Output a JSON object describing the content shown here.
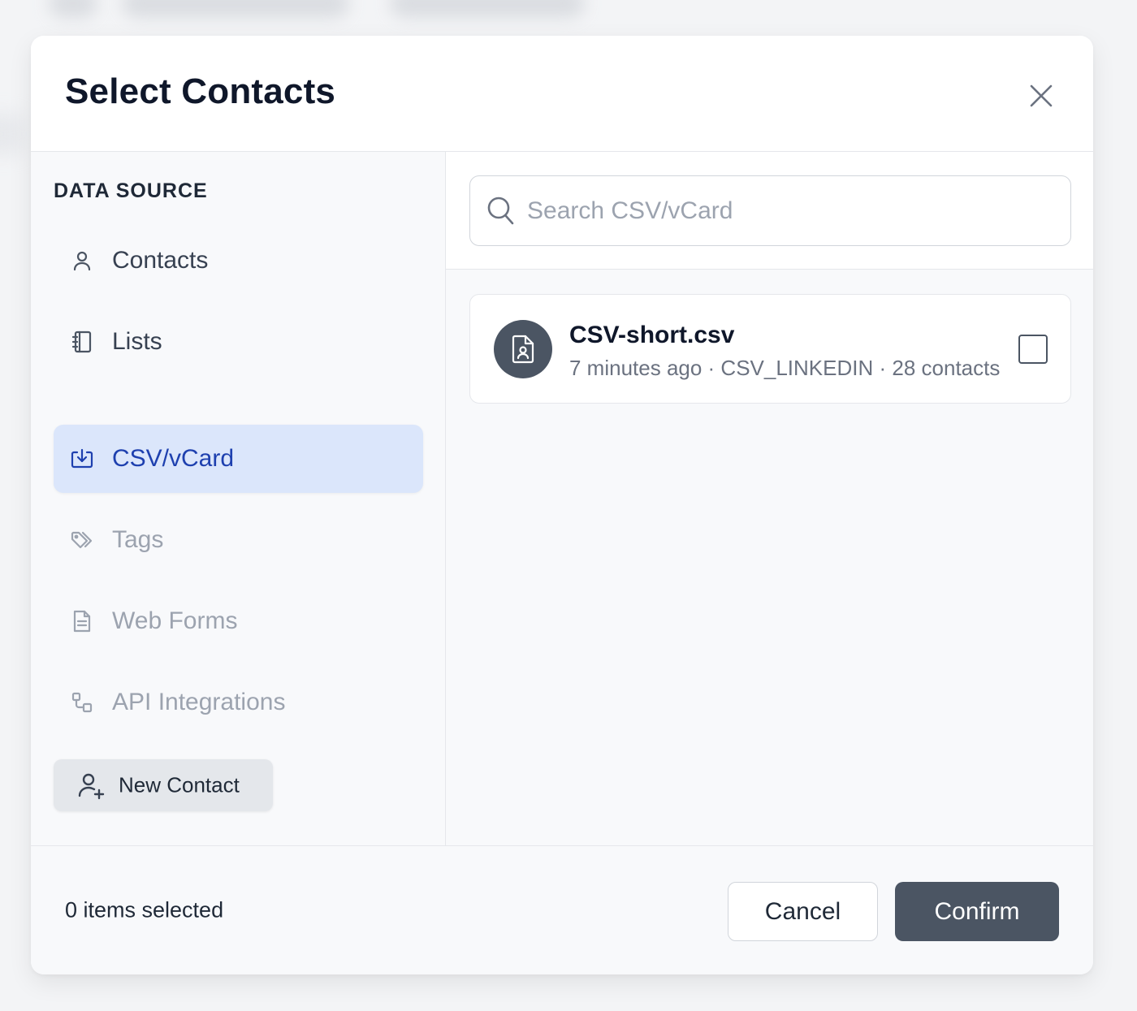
{
  "modal": {
    "title": "Select Contacts"
  },
  "sidebar": {
    "heading": "DATA SOURCE",
    "items": [
      {
        "label": "Contacts",
        "icon": "user-icon",
        "state": "enabled"
      },
      {
        "label": "Lists",
        "icon": "notebook-icon",
        "state": "enabled"
      },
      {
        "label": "CSV/vCard",
        "icon": "import-icon",
        "state": "active"
      },
      {
        "label": "Tags",
        "icon": "tags-icon",
        "state": "disabled"
      },
      {
        "label": "Web Forms",
        "icon": "document-icon",
        "state": "disabled"
      },
      {
        "label": "API Integrations",
        "icon": "integration-icon",
        "state": "disabled"
      }
    ],
    "new_contact_label": "New Contact"
  },
  "search": {
    "placeholder": "Search CSV/vCard",
    "value": ""
  },
  "files": [
    {
      "name": "CSV-short.csv",
      "meta": "7 minutes ago · CSV_LINKEDIN · 28 contacts",
      "icon": "contact-file-icon",
      "checked": false
    }
  ],
  "footer": {
    "selected_text": "0 items selected",
    "cancel_label": "Cancel",
    "confirm_label": "Confirm"
  },
  "colors": {
    "active_bg": "#dbe6fb",
    "active_text": "#1e40af",
    "confirm_bg": "#4b5563",
    "disabled_text": "#9ca3af"
  }
}
